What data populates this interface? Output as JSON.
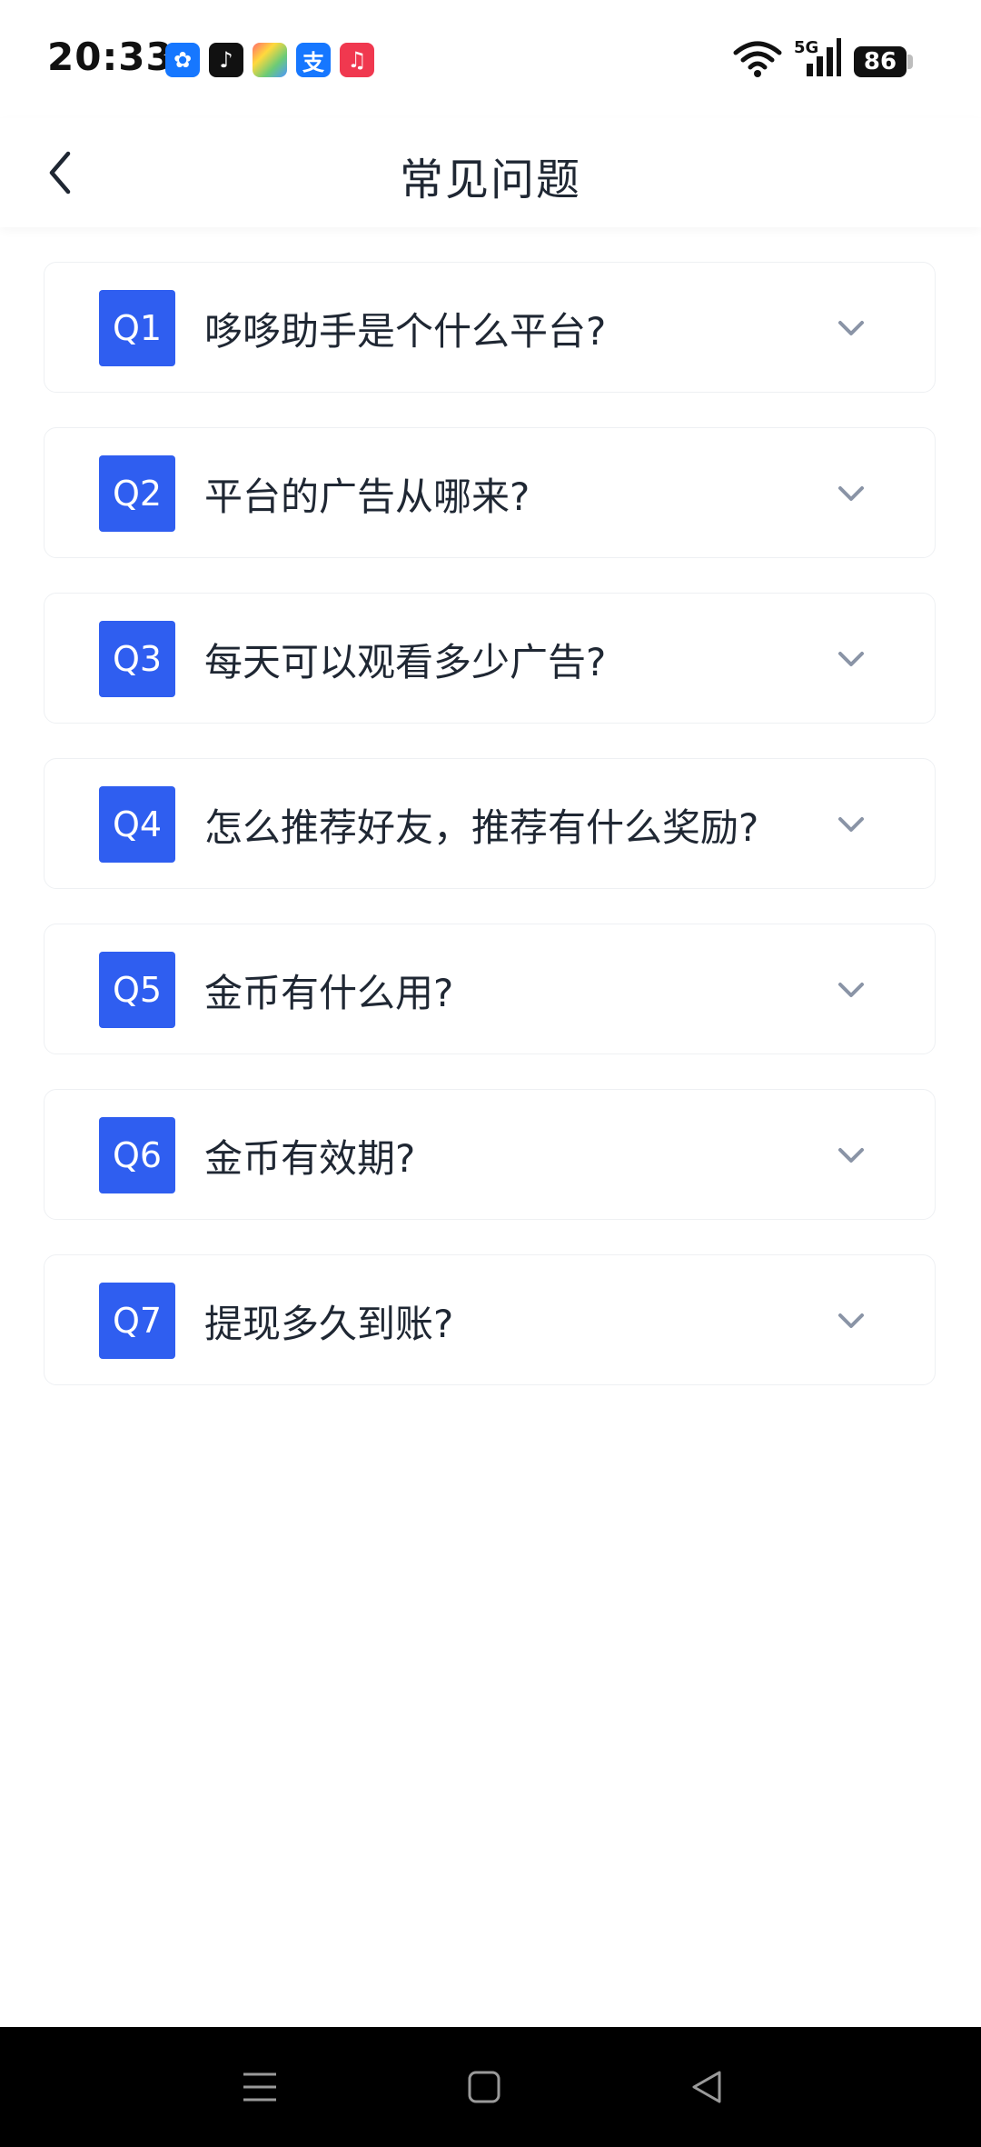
{
  "status_bar": {
    "time": "20:33",
    "battery": "86",
    "network": "5G",
    "app_icons": [
      "pinwheel-icon",
      "tiktok-icon",
      "map-app-icon",
      "alipay-icon",
      "music-icon"
    ]
  },
  "header": {
    "title": "常见问题",
    "back_icon": "chevron-left-icon"
  },
  "faq": [
    {
      "badge": "Q1",
      "question": "哆哆助手是个什么平台?"
    },
    {
      "badge": "Q2",
      "question": "平台的广告从哪来?"
    },
    {
      "badge": "Q3",
      "question": "每天可以观看多少广告?"
    },
    {
      "badge": "Q4",
      "question": "怎么推荐好友，推荐有什么奖励?"
    },
    {
      "badge": "Q5",
      "question": "金币有什么用?"
    },
    {
      "badge": "Q6",
      "question": "金币有效期?"
    },
    {
      "badge": "Q7",
      "question": "提现多久到账?"
    }
  ],
  "colors": {
    "accent": "#2f5ef0",
    "text": "#1f2733",
    "chevron": "#8a94a6",
    "card_border": "#eef0f3"
  },
  "nav": {
    "icons": [
      "menu-icon",
      "home-icon",
      "back-triangle-icon"
    ]
  }
}
